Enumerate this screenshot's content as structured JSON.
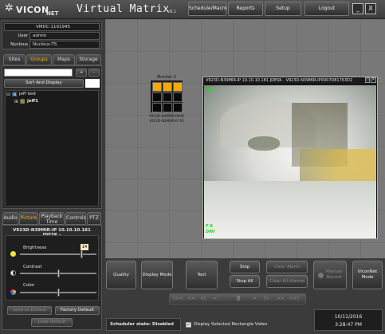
{
  "header": {
    "logo_text": "VICON",
    "logo_sub": "NET",
    "title": "Virtual Matrix",
    "version": "v8.1",
    "buttons": [
      "Schedule/Macro",
      "Reports",
      "Setup",
      "Logout"
    ],
    "minimize": "_",
    "close": "X"
  },
  "info": {
    "server": "VMDC-1191945",
    "user_label": "User",
    "user_value": "admin",
    "nucleus_label": "Nucleus",
    "nucleus_value": "Nucleus-TS"
  },
  "nav_tabs": [
    {
      "label": "Sites",
      "active": false
    },
    {
      "label": "Groups",
      "active": true
    },
    {
      "label": "Maps",
      "active": false
    },
    {
      "label": "Storage",
      "active": false
    }
  ],
  "tree": {
    "search_value": "",
    "up_label": "+",
    "down_label": "-",
    "sort_label": "Sort And Display",
    "root": "jeff test",
    "child": "jeff1"
  },
  "ctrl_tabs": [
    {
      "label": "Audio",
      "active": false
    },
    {
      "label": "Picture",
      "active": true
    },
    {
      "label": "Playback Time",
      "active": false
    },
    {
      "label": "Controls",
      "active": false
    },
    {
      "label": "PTZ",
      "active": false
    }
  ],
  "picture": {
    "camera": "V923D-N39MIR-IP 10.10.10.181 JDESK -",
    "brightness_label": "Brightness",
    "brightness_value": "14",
    "brightness_level": 0.82,
    "contrast_label": "Contrast",
    "contrast_level": 0.5,
    "color_label": "Color",
    "color_level": 0.5,
    "save_default": "Save as Default",
    "factory_default": "Factory Default",
    "load_default": "Load Default"
  },
  "monitor": {
    "title": "Monitor 2",
    "cells_on": [
      0,
      1,
      2
    ],
    "caption_1": "V923D-N39MIR-IP0007D",
    "caption_2": "V923D-N39MIR-IP 10.10."
  },
  "video": {
    "title": "V923D-N39MIR-IP 10.10.10.181 JDESK - V923D-N39MIR-IP0007D81763D2",
    "overlay_top": "ive",
    "overlay_bottom_1": "P  8",
    "overlay_bottom_2": "DAV"
  },
  "actions": [
    "Quality",
    "Display Mode",
    "Text",
    "Stop",
    "Stop All",
    "Clear Alarm",
    "Clear All Alarms",
    "Manual Record",
    "ViconNet Mode"
  ],
  "playback": [
    "|<<",
    "<<",
    "<|",
    "<",
    "||",
    ">",
    "|>",
    ">>",
    ">>|"
  ],
  "status": {
    "scheduler": "Scheduler state: Disabled",
    "display_selected": "Display Selected Rectangle Video",
    "date": "10/11/2016",
    "time": "3:28:47 PM"
  },
  "colors": {
    "accent": "#f0b400",
    "active_cell": "#f2a900",
    "video_title_bg": "#1a1a1a"
  }
}
